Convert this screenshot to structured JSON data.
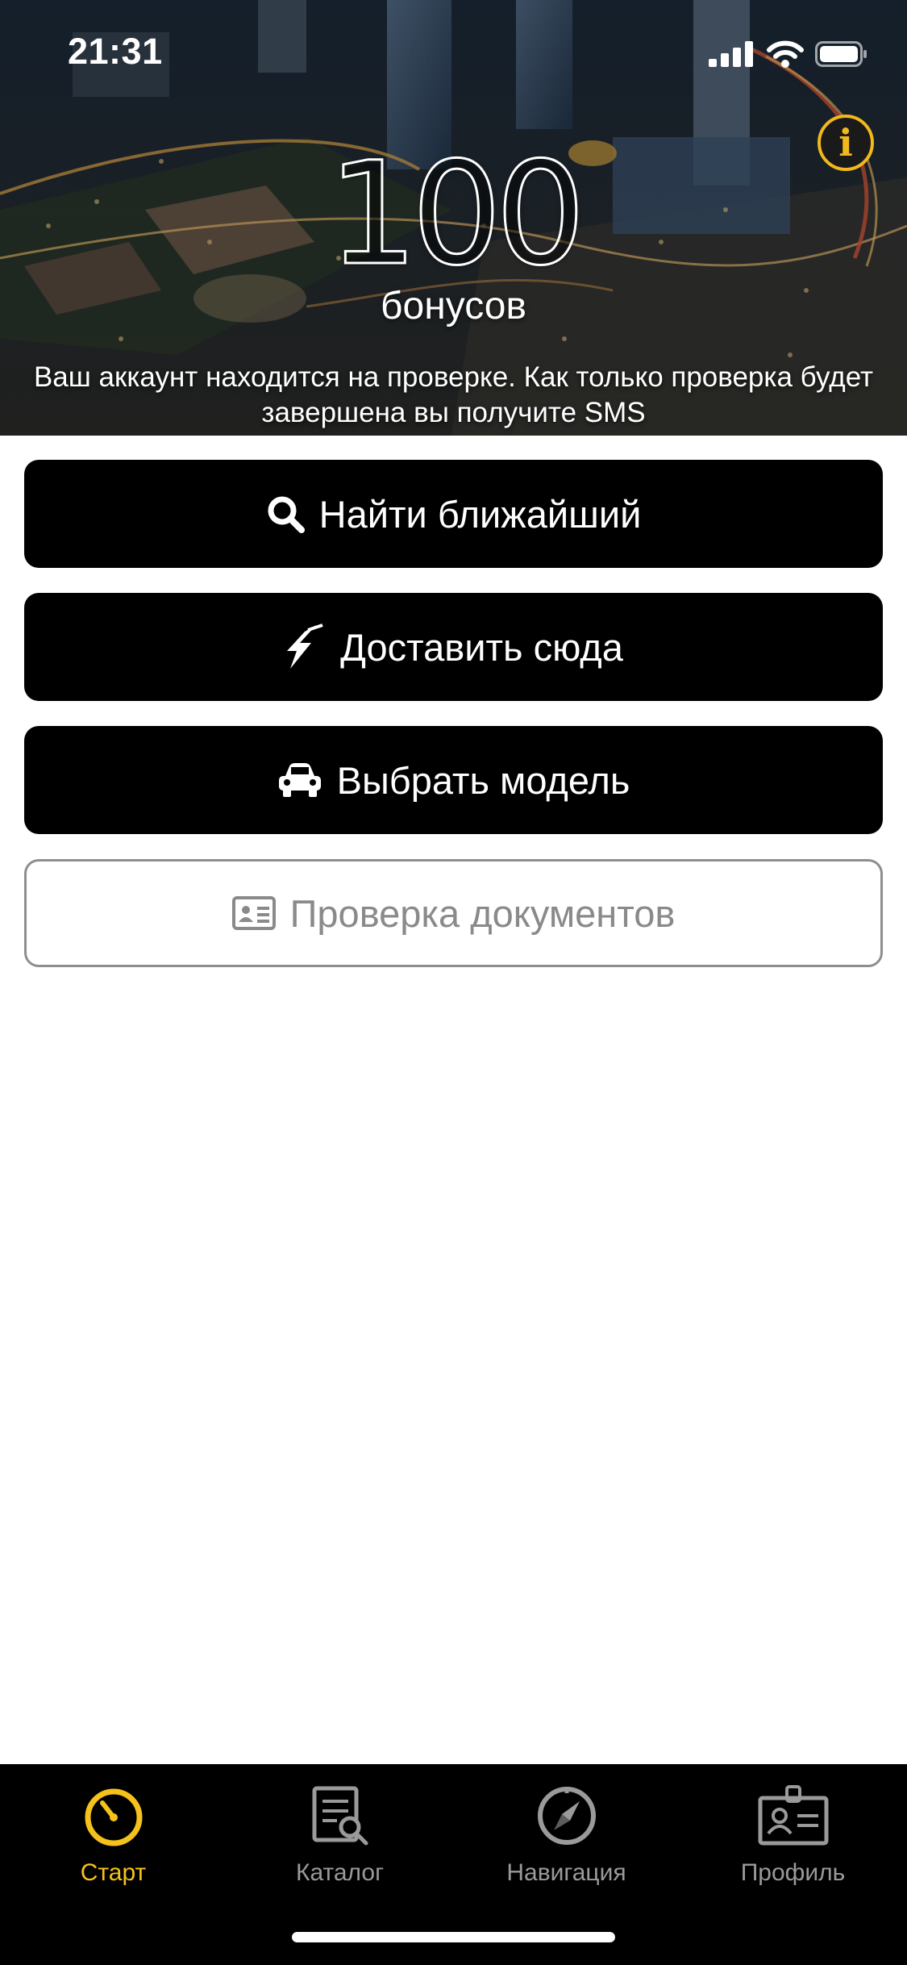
{
  "status_bar": {
    "time": "21:31"
  },
  "hero": {
    "bonus_value": "100",
    "bonus_label": "бонусов",
    "account_note": "Ваш аккаунт находится на проверке. Как только проверка будет завершена вы получите SMS",
    "info_glyph": "i"
  },
  "actions": [
    {
      "label": "Найти ближайший",
      "icon": "search-icon"
    },
    {
      "label": "Доставить сюда",
      "icon": "lightning-icon"
    },
    {
      "label": "Выбрать модель",
      "icon": "car-icon"
    },
    {
      "label": "Проверка документов",
      "icon": "id-card-icon"
    }
  ],
  "tabbar": {
    "items": [
      {
        "label": "Старт",
        "icon": "stopwatch-icon",
        "active": true
      },
      {
        "label": "Каталог",
        "icon": "catalog-search-icon",
        "active": false
      },
      {
        "label": "Навигация",
        "icon": "compass-icon",
        "active": false
      },
      {
        "label": "Профиль",
        "icon": "badge-icon",
        "active": false
      }
    ]
  },
  "colors": {
    "accent": "#f5c21b",
    "button_bg": "#000000",
    "tab_inactive": "#9a9a9a",
    "outline_gray": "#8e8e8e"
  }
}
